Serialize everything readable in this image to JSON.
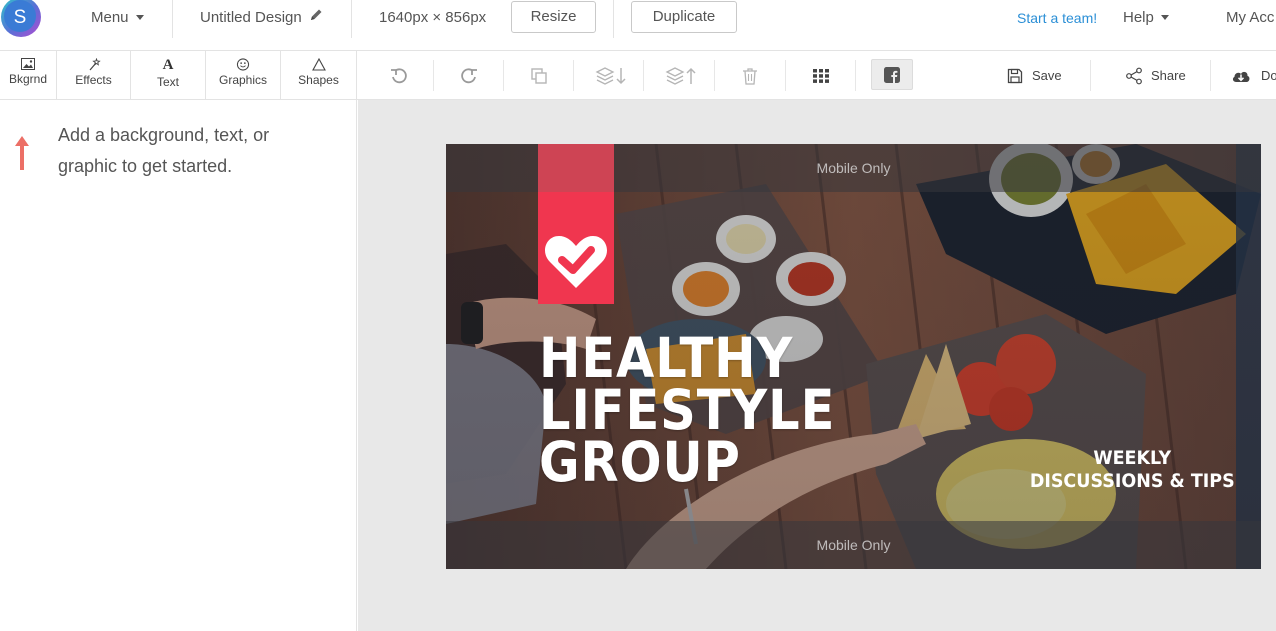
{
  "topbar": {
    "logo_letter": "S",
    "menu_label": "Menu",
    "design_title": "Untitled Design",
    "dimensions": "1640px × 856px",
    "resize_label": "Resize",
    "duplicate_label": "Duplicate",
    "team_link": "Start a team!",
    "help_label": "Help",
    "account_label": "My Acc"
  },
  "tool_tabs": [
    {
      "label": "Bkgrnd",
      "icon": "image-icon"
    },
    {
      "label": "Effects",
      "icon": "magic-wand-icon"
    },
    {
      "label": "Text",
      "icon": "text-icon",
      "glyph": "A"
    },
    {
      "label": "Graphics",
      "icon": "smiley-icon"
    },
    {
      "label": "Shapes",
      "icon": "triangle-icon"
    }
  ],
  "left_panel": {
    "hint": "Add a background, text, or graphic to get started."
  },
  "toolbar": {
    "save_label": "Save",
    "share_label": "Share",
    "download_label": "Do"
  },
  "design": {
    "mobile_top": "Mobile Only",
    "mobile_bottom": "Mobile Only",
    "headline_lines": [
      "HEALTHY",
      "LIFESTYLE",
      "GROUP"
    ],
    "sub_lines": [
      "WEEKLY",
      "DISCUSSIONS & TIPS"
    ]
  },
  "colors": {
    "accent_red": "#f0364f",
    "link_blue": "#2b8fd6",
    "hint_arrow": "#ec6f66",
    "canvas_bg": "#e8e8e8"
  }
}
